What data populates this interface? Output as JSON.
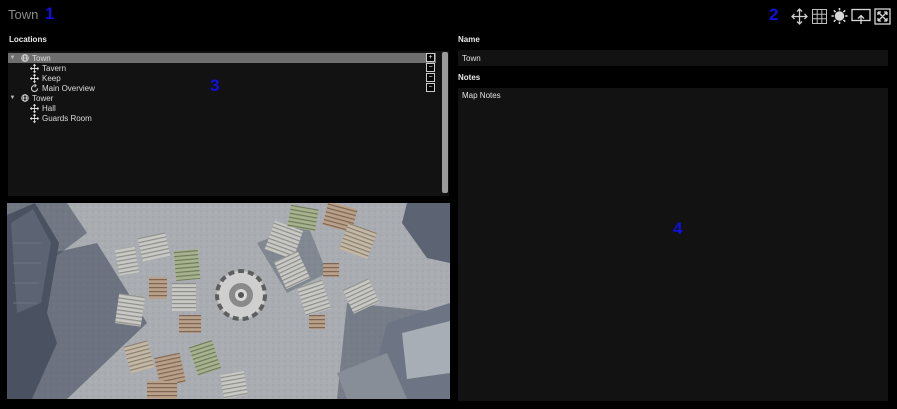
{
  "window": {
    "title": "Town"
  },
  "markers": {
    "m1": "1",
    "m2": "2",
    "m3": "3",
    "m4": "4"
  },
  "toolbar": {
    "icons": [
      "move-icon",
      "grid-icon",
      "brightness-icon",
      "cast-screen-icon",
      "fullscreen-icon"
    ]
  },
  "locations": {
    "label": "Locations",
    "tree": [
      {
        "label": "Town",
        "icon": "globe-icon",
        "expanded": true,
        "selected": true,
        "button": "+"
      },
      {
        "label": "Tavern",
        "icon": "move-icon",
        "button": "−"
      },
      {
        "label": "Keep",
        "icon": "move-icon",
        "button": "−"
      },
      {
        "label": "Main Overview",
        "icon": "rotate-icon",
        "button": "−"
      },
      {
        "label": "Tower",
        "icon": "globe-icon",
        "expanded": true
      },
      {
        "label": "Hall",
        "icon": "move-icon"
      },
      {
        "label": "Guards Room",
        "icon": "move-icon"
      }
    ]
  },
  "details": {
    "name_label": "Name",
    "name_value": "Town",
    "notes_label": "Notes",
    "notes_value": "Map Notes"
  },
  "colors": {
    "background": "#000000",
    "panel": "#121212",
    "selected_row": "#6f6f6f",
    "marker": "#1010e0"
  }
}
